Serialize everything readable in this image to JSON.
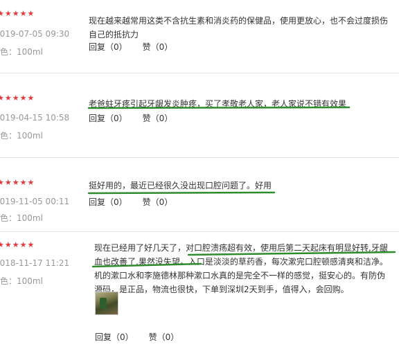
{
  "reviews": [
    {
      "stars": "★★★★★",
      "date": "2019-07-05 09:30",
      "variant": "颜色：100ml",
      "lines": [
        "现在越来越常用这类不含抗生素和消炎药的保健品，使用更放心，也不会过度损伤",
        "自己的抵抗力"
      ],
      "reply": "回复（0）",
      "like": "赞（0）"
    },
    {
      "stars": "★★★★★",
      "date": "2019-04-15 10:58",
      "variant": "颜色：100ml",
      "lines": [
        "老爸蛀牙疼引起牙龈发炎肿疼，买了孝敬老人家，老人家说不错有效果"
      ],
      "reply": "回复（0）",
      "like": "赞（0）"
    },
    {
      "stars": "★★★★★",
      "date": "2019-11-05 00:11",
      "variant": "颜色：100ml",
      "lines": [
        "挺好用的，最近已经很久没出现口腔问题了。好用"
      ],
      "reply": "回复（0）",
      "like": "赞（0）"
    },
    {
      "stars": "★★★★★",
      "date": "2018-11-17 11:21",
      "variant": "颜色：100ml",
      "lines": [
        "现在已经用了好几天了，对口腔溃疡超有效，使用后第二天起床有明显好转,牙龈",
        "血也改善了,果然没失望。入口是淡淡的草药香，每次漱完口腔顿感清爽和洁净。",
        "机的漱口水和李施德林那种漱口水真的是完全不一样的感觉，挺安心的。有防伪",
        "源码，是正品，物流也很快，下单到深圳2天到手，值得入，会回购。"
      ],
      "reply": "回复（0）",
      "like": "赞（0）"
    }
  ],
  "colors": {
    "stars": "#e4393c",
    "underline": "#2e8b2e",
    "meta": "#999999"
  }
}
